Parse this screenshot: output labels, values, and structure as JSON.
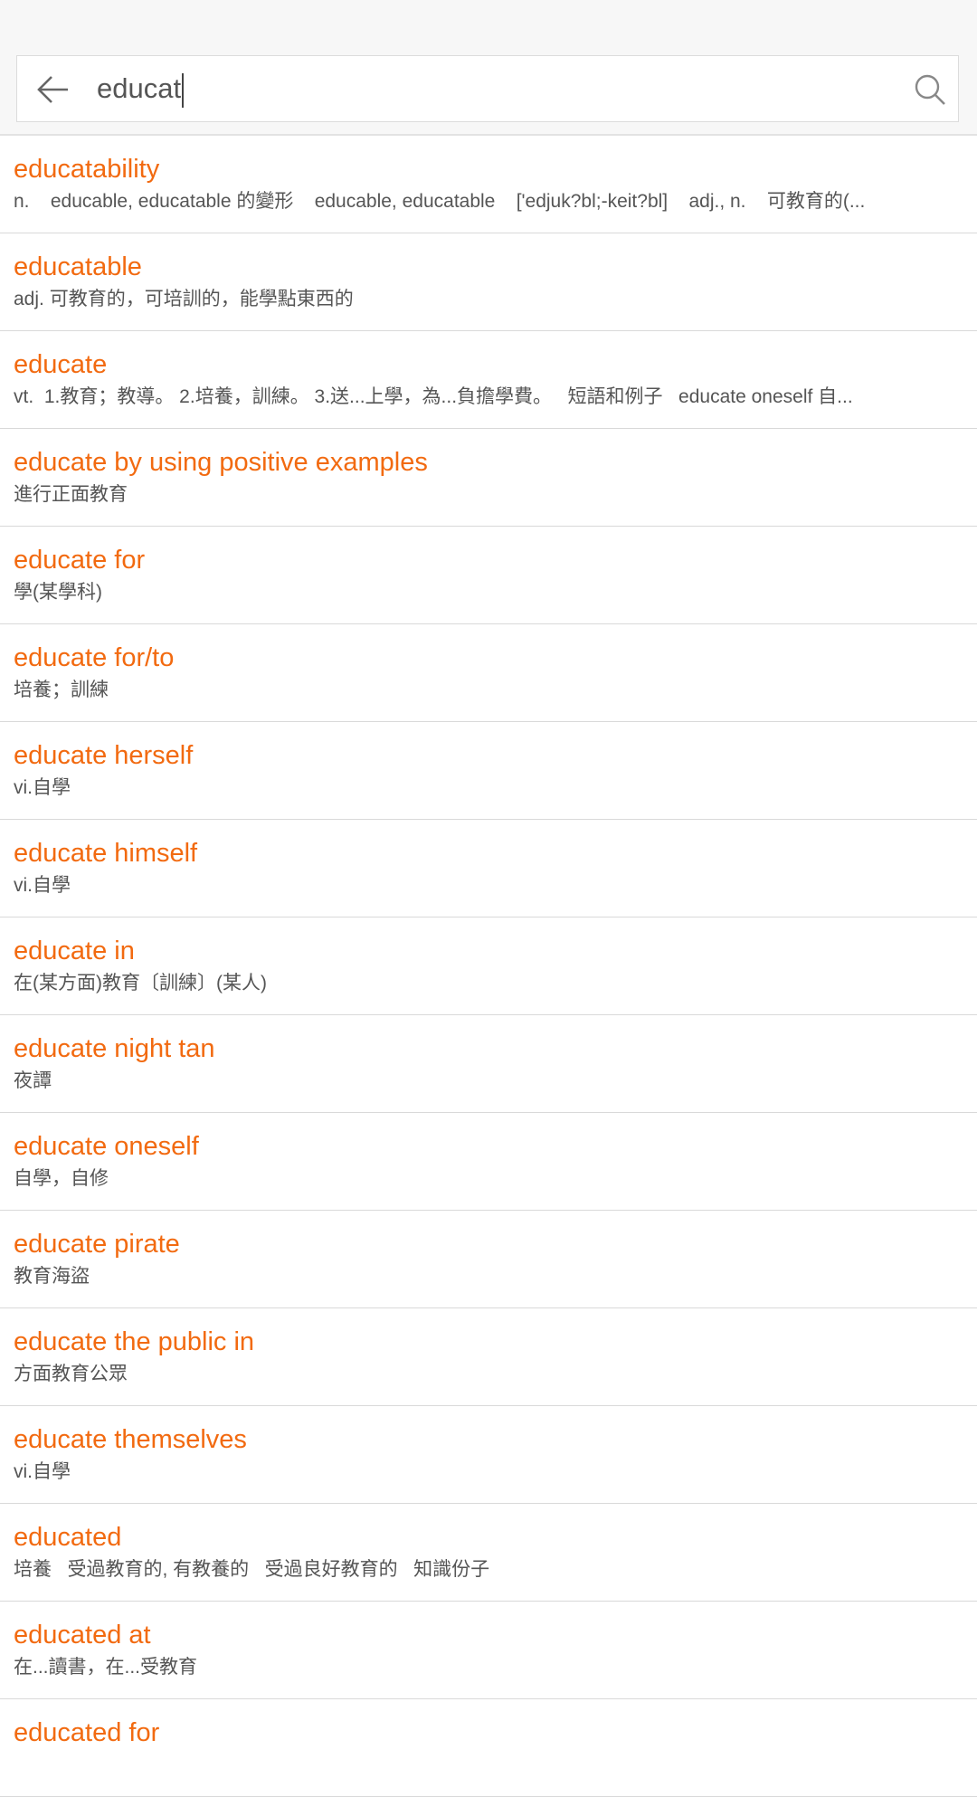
{
  "search": {
    "query": "educat",
    "back_icon": "arrow-left-icon",
    "search_icon": "search-icon"
  },
  "colors": {
    "accent": "#f26a10",
    "text": "#555555",
    "divider": "#d9d9d9"
  },
  "results": [
    {
      "word": "educatability",
      "definition": "n.    educable, educatable 的變形    educable, educatable    ['edjuk?bl;-keit?bl]    adj., n.    可教育的(..."
    },
    {
      "word": "educatable",
      "definition": "adj. 可教育的，可培訓的，能學點東西的"
    },
    {
      "word": "educate",
      "definition": "vt.  1.教育；教導。 2.培養，訓練。 3.送...上學，為...負擔學費。   短語和例子   educate oneself 自..."
    },
    {
      "word": "educate by using positive examples",
      "definition": "進行正面教育"
    },
    {
      "word": "educate for",
      "definition": "學(某學科)"
    },
    {
      "word": "educate for/to",
      "definition": "培養；訓練"
    },
    {
      "word": "educate herself",
      "definition": "vi.自學"
    },
    {
      "word": "educate himself",
      "definition": "vi.自學"
    },
    {
      "word": "educate in",
      "definition": "在(某方面)教育〔訓練〕(某人)"
    },
    {
      "word": "educate night tan",
      "definition": "夜譚"
    },
    {
      "word": "educate oneself",
      "definition": "自學，自修"
    },
    {
      "word": "educate pirate",
      "definition": "教育海盜"
    },
    {
      "word": "educate the public in",
      "definition": "方面教育公眾"
    },
    {
      "word": "educate themselves",
      "definition": "vi.自學"
    },
    {
      "word": "educated",
      "definition": "培養   受過教育的, 有教養的   受過良好教育的   知識份子"
    },
    {
      "word": "educated at",
      "definition": "在...讀書，在...受教育"
    },
    {
      "word": "educated for",
      "definition": ""
    }
  ]
}
